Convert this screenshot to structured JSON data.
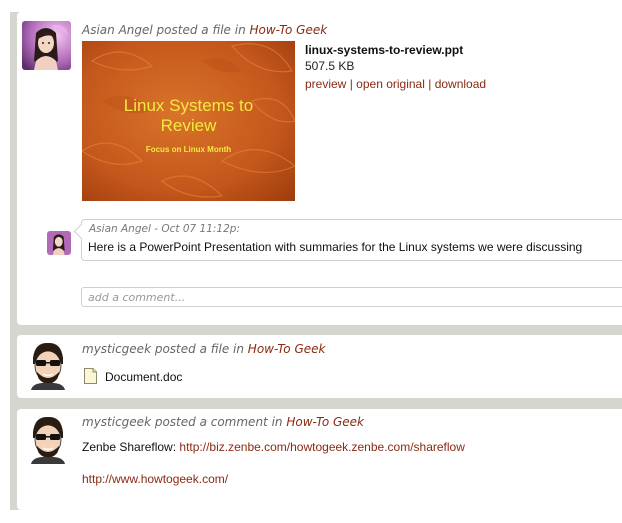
{
  "colors": {
    "link": "#8a2a12",
    "frame": "#d5d7ce",
    "slide_bg": "#c4571c",
    "slide_text": "#f3ea40"
  },
  "post1": {
    "author": "Asian Angel",
    "action": "posted a file in",
    "group": "How-To Geek",
    "slide": {
      "title_line1": "Linux Systems to",
      "title_line2": "Review",
      "subtitle": "Focus on Linux Month"
    },
    "file_name": "linux-systems-to-review.ppt",
    "file_size": "507.5 KB",
    "actions": {
      "preview": "preview",
      "open_original": "open original",
      "download": "download",
      "separator": "|"
    },
    "comment": {
      "meta": "Asian Angel - Oct 07 11:12p:",
      "text": "Here is a PowerPoint Presentation with summaries for the Linux systems we were discussing"
    },
    "add_comment_placeholder": "add a comment..."
  },
  "post2": {
    "author": "mysticgeek",
    "action": "posted a file in",
    "group": "How-To Geek",
    "file_name": "Document.doc",
    "icon": "document-icon"
  },
  "post3": {
    "author": "mysticgeek",
    "action": "posted a comment in",
    "group": "How-To Geek",
    "shareflow_label": "Zenbe Shareflow:",
    "shareflow_url": "http://biz.zenbe.com/howtogeek.zenbe.com/shareflow",
    "extra_url": "http://www.howtogeek.com/"
  }
}
